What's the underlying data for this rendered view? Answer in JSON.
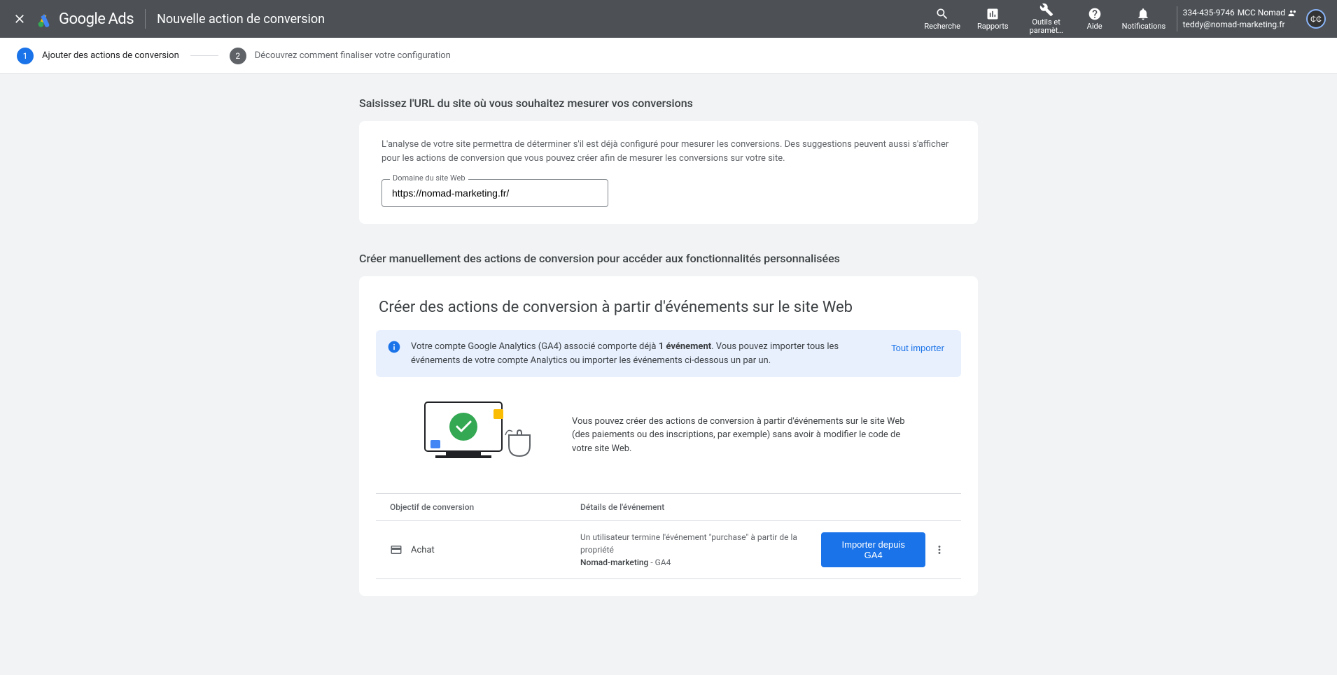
{
  "header": {
    "logo_google": "Google",
    "logo_ads": "Ads",
    "page_title": "Nouvelle action de conversion"
  },
  "nav": {
    "search": "Recherche",
    "reports": "Rapports",
    "tools": "Outils et paramèt…",
    "help": "Aide",
    "notifications": "Notifications"
  },
  "account": {
    "id": "334-435-9746",
    "name": "MCC Nomad",
    "email": "teddy@nomad-marketing.fr",
    "avatar_initials": "₵₵"
  },
  "stepper": {
    "step1": "Ajouter des actions de conversion",
    "step2": "Découvrez comment finaliser votre configuration"
  },
  "section1": {
    "title": "Saisissez l'URL du site où vous souhaitez mesurer vos conversions",
    "description": "L'analyse de votre site permettra de déterminer s'il est déjà configuré pour mesurer les conversions. Des suggestions peuvent aussi s'afficher pour les actions de conversion que vous pouvez créer afin de mesurer les conversions sur votre site.",
    "input_label": "Domaine du site Web",
    "input_value": "https://nomad-marketing.fr/"
  },
  "section2": {
    "title": "Créer manuellement des actions de conversion pour accéder aux fonctionnalités personnalisées",
    "card_title": "Créer des actions de conversion à partir d'événements sur le site Web",
    "banner_pre": "Votre compte Google Analytics (GA4) associé comporte déjà ",
    "banner_bold": "1 événement",
    "banner_post": ". Vous pouvez importer tous les événements de votre compte Analytics ou importer les événements ci-dessous un par un.",
    "banner_button": "Tout importer",
    "description": "Vous pouvez créer des actions de conversion à partir d'événements sur le site Web (des paiements ou des inscriptions, par exemple) sans avoir à modifier le code de votre site Web.",
    "table": {
      "col1": "Objectif de conversion",
      "col2": "Détails de l'événement"
    },
    "row": {
      "goal": "Achat",
      "detail_line1": "Un utilisateur termine l'événement \"purchase\" à partir de la propriété",
      "detail_property": "Nomad-marketing",
      "detail_suffix": "  - GA4",
      "button": "Importer depuis GA4"
    }
  }
}
